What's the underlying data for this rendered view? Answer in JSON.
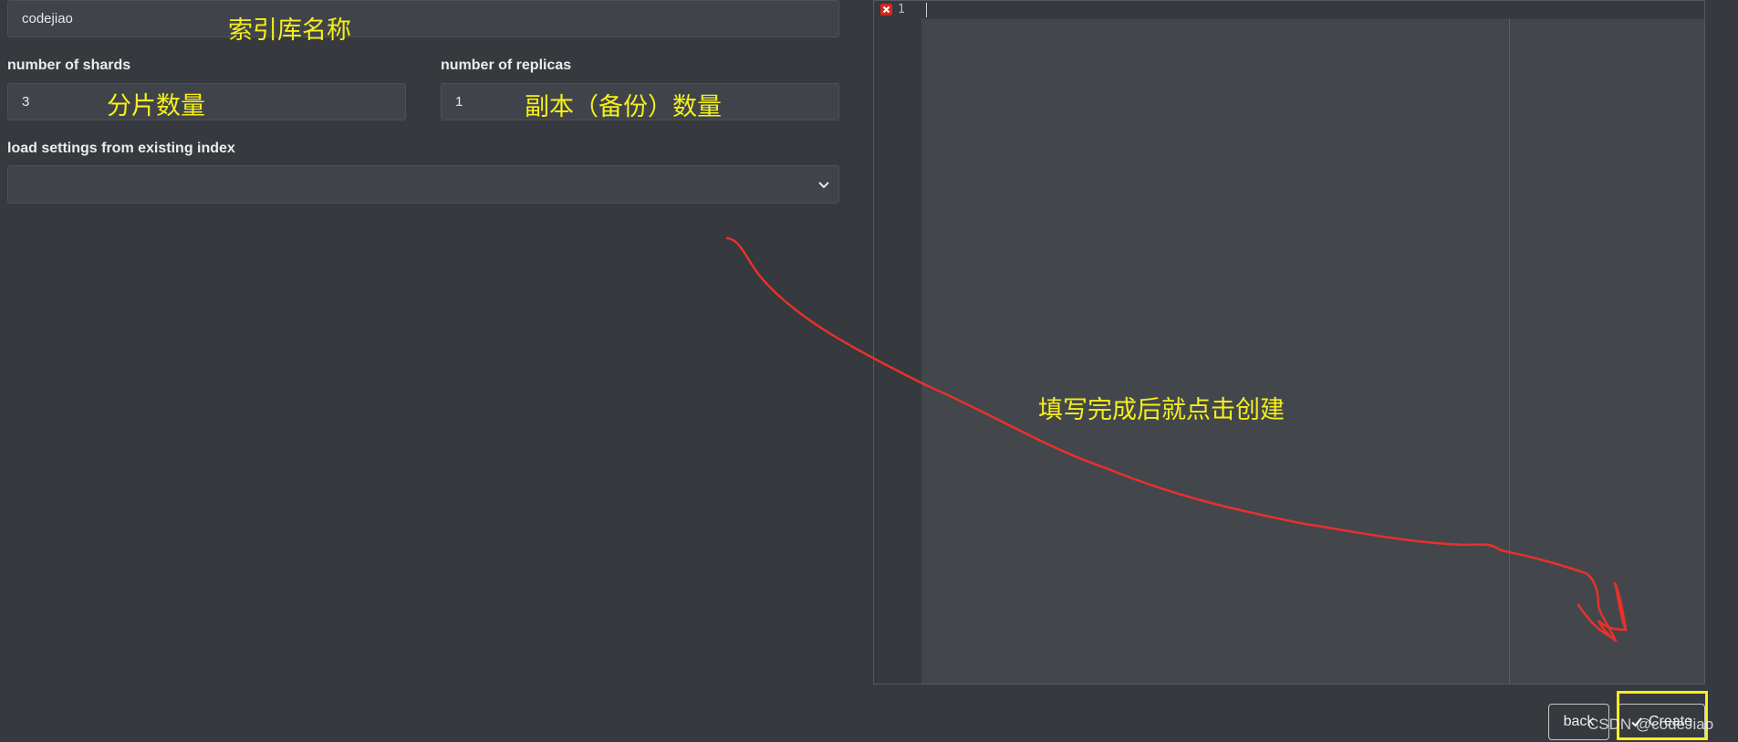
{
  "form": {
    "index_name": {
      "value": "codejiao",
      "annotation": "索引库名称"
    },
    "shards": {
      "label": "number of shards",
      "value": "3",
      "annotation": "分片数量"
    },
    "replicas": {
      "label": "number of replicas",
      "value": "1",
      "annotation": "副本（备份）数量"
    },
    "load_settings": {
      "label": "load settings from existing index",
      "value": ""
    }
  },
  "editor": {
    "line_numbers": [
      "1"
    ],
    "content": ""
  },
  "annotations": {
    "instruction": "填写完成后就点击创建"
  },
  "actions": {
    "back_label": "back",
    "create_label": "Create"
  },
  "watermark": "CSDN @codeJiao",
  "colors": {
    "annotation": "#f5ef1a",
    "arrow": "#e8312a",
    "error": "#d8261c"
  }
}
